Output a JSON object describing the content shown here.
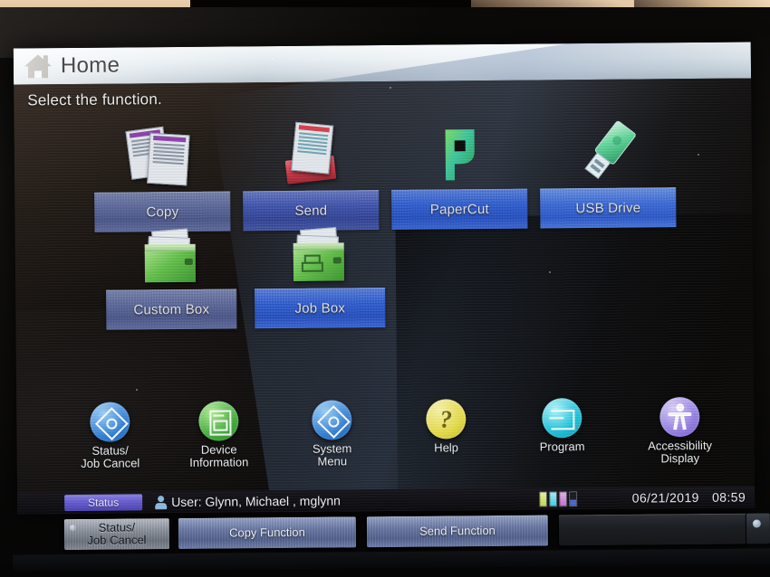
{
  "header": {
    "title": "Home",
    "home_icon": "home-icon"
  },
  "prompt": "Select the function.",
  "functions": [
    {
      "label": "Copy",
      "icon": "documents-icon",
      "name": "copy"
    },
    {
      "label": "Send",
      "icon": "send-tray-icon",
      "name": "send"
    },
    {
      "label": "PaperCut",
      "icon": "papercut-logo-icon",
      "name": "papercut"
    },
    {
      "label": "USB Drive",
      "icon": "usb-drive-icon",
      "name": "usb-drive"
    },
    {
      "label": "Custom Box",
      "icon": "green-box-icon",
      "name": "custom-box"
    },
    {
      "label": "Job Box",
      "icon": "green-job-box-icon",
      "name": "job-box"
    }
  ],
  "utility": [
    {
      "label_line1": "Status/",
      "label_line2": "Job Cancel",
      "icon": "status-diamond-icon",
      "color": "#2f7fd8"
    },
    {
      "label_line1": "Device",
      "label_line2": "Information",
      "icon": "device-info-icon",
      "color": "#3fae3a"
    },
    {
      "label_line1": "System",
      "label_line2": "Menu",
      "icon": "system-menu-diamond-icon",
      "color": "#2f7fd8"
    },
    {
      "label_line1": "Help",
      "label_line2": "",
      "icon": "question-mark-icon",
      "color": "#e8df4a"
    },
    {
      "label_line1": "Program",
      "label_line2": "",
      "icon": "program-arrow-icon",
      "color": "#1fc6de"
    },
    {
      "label_line1": "Accessibility",
      "label_line2": "Display",
      "icon": "accessibility-person-icon",
      "color": "#9b84e8"
    }
  ],
  "statusbar": {
    "badge": "Status",
    "user_icon": "user-icon",
    "user_text": "User: Glynn, Michael , mglynn",
    "toner": [
      {
        "name": "yellow",
        "color": "#c9dd4a",
        "level": 100
      },
      {
        "name": "cyan",
        "color": "#3fd2e8",
        "level": 100
      },
      {
        "name": "magenta",
        "color": "#cf6fd8",
        "level": 100
      },
      {
        "name": "black",
        "color": "#4a6ad0",
        "level": 45
      }
    ],
    "date": "06/21/2019",
    "time": "08:59"
  },
  "taskbar": [
    {
      "label_line1": "Status/",
      "label_line2": "Job Cancel",
      "style": "grey",
      "name": "status-job-cancel"
    },
    {
      "label_line1": "Copy Function",
      "label_line2": "",
      "style": "blue",
      "name": "copy-function"
    },
    {
      "label_line1": "Send Function",
      "label_line2": "",
      "style": "blue",
      "name": "send-function"
    },
    {
      "label_line1": "",
      "label_line2": "",
      "style": "empty",
      "name": "empty-slot"
    }
  ]
}
